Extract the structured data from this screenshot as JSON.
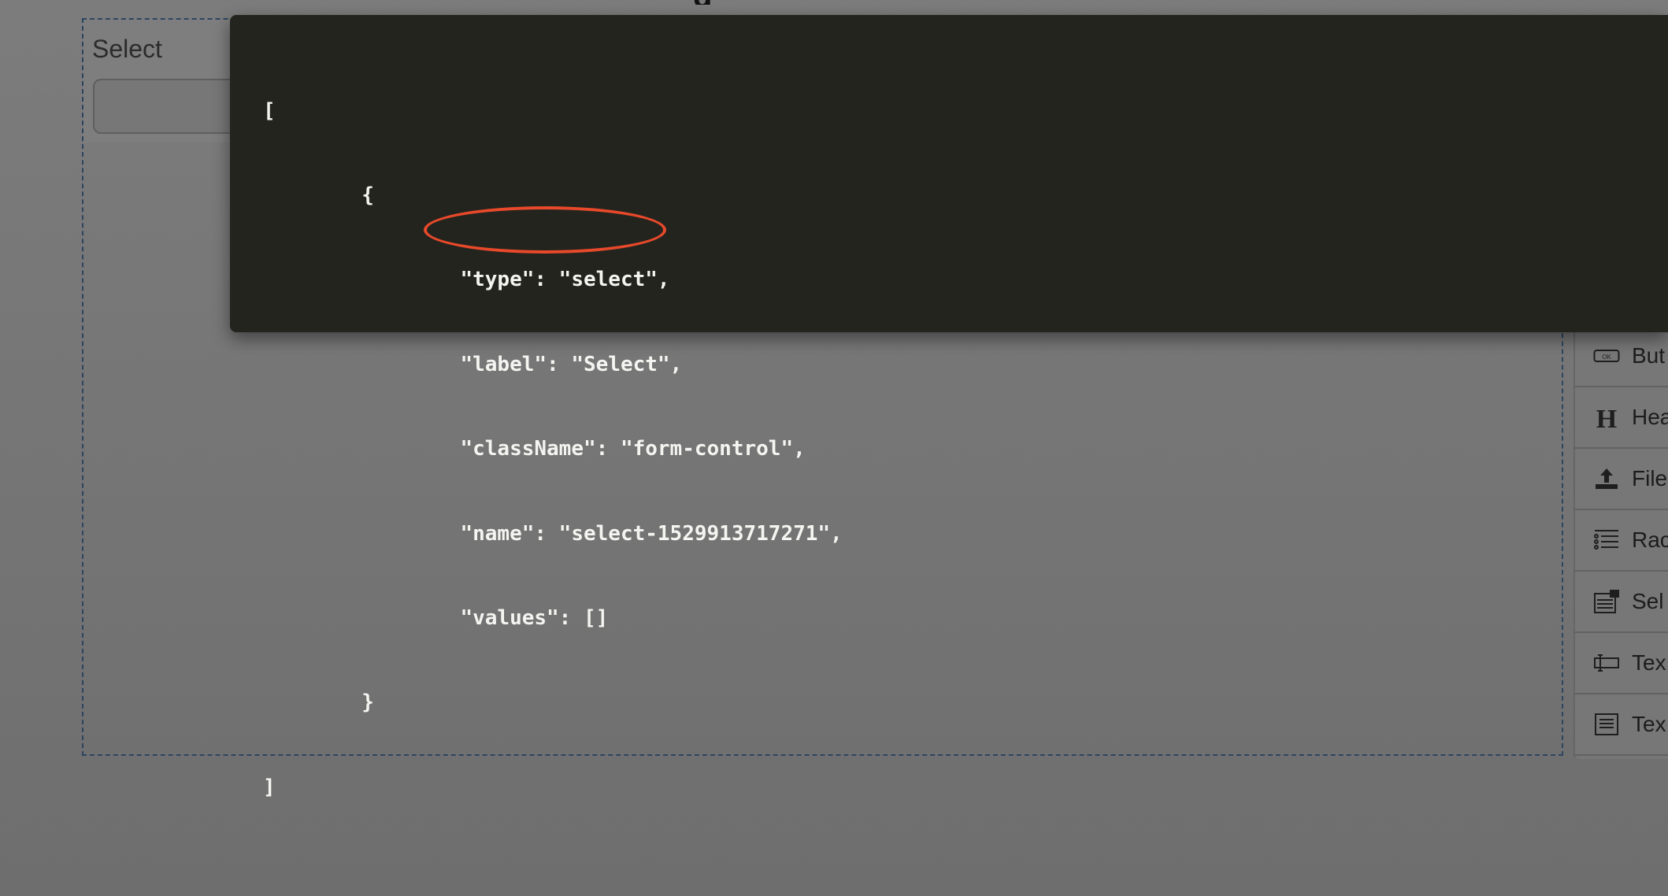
{
  "form_builder": {
    "field_label": "Select"
  },
  "json_view": {
    "lines": [
      "[",
      "        {",
      "                \"type\": \"select\",",
      "                \"label\": \"Select\",",
      "                \"className\": \"form-control\",",
      "                \"name\": \"select-1529913717271\",",
      "                \"values\": []",
      "        }",
      "]"
    ],
    "highlight_color": "#e8492a"
  },
  "toolbox": {
    "items": [
      {
        "label": "But",
        "icon": "button-icon"
      },
      {
        "label": "Hea",
        "icon": "header-icon"
      },
      {
        "label": "File",
        "icon": "file-upload-icon"
      },
      {
        "label": "Rac",
        "icon": "radio-group-icon"
      },
      {
        "label": "Sel",
        "icon": "select-icon"
      },
      {
        "label": "Tex",
        "icon": "text-field-icon"
      },
      {
        "label": "Tex",
        "icon": "text-area-icon"
      }
    ]
  }
}
